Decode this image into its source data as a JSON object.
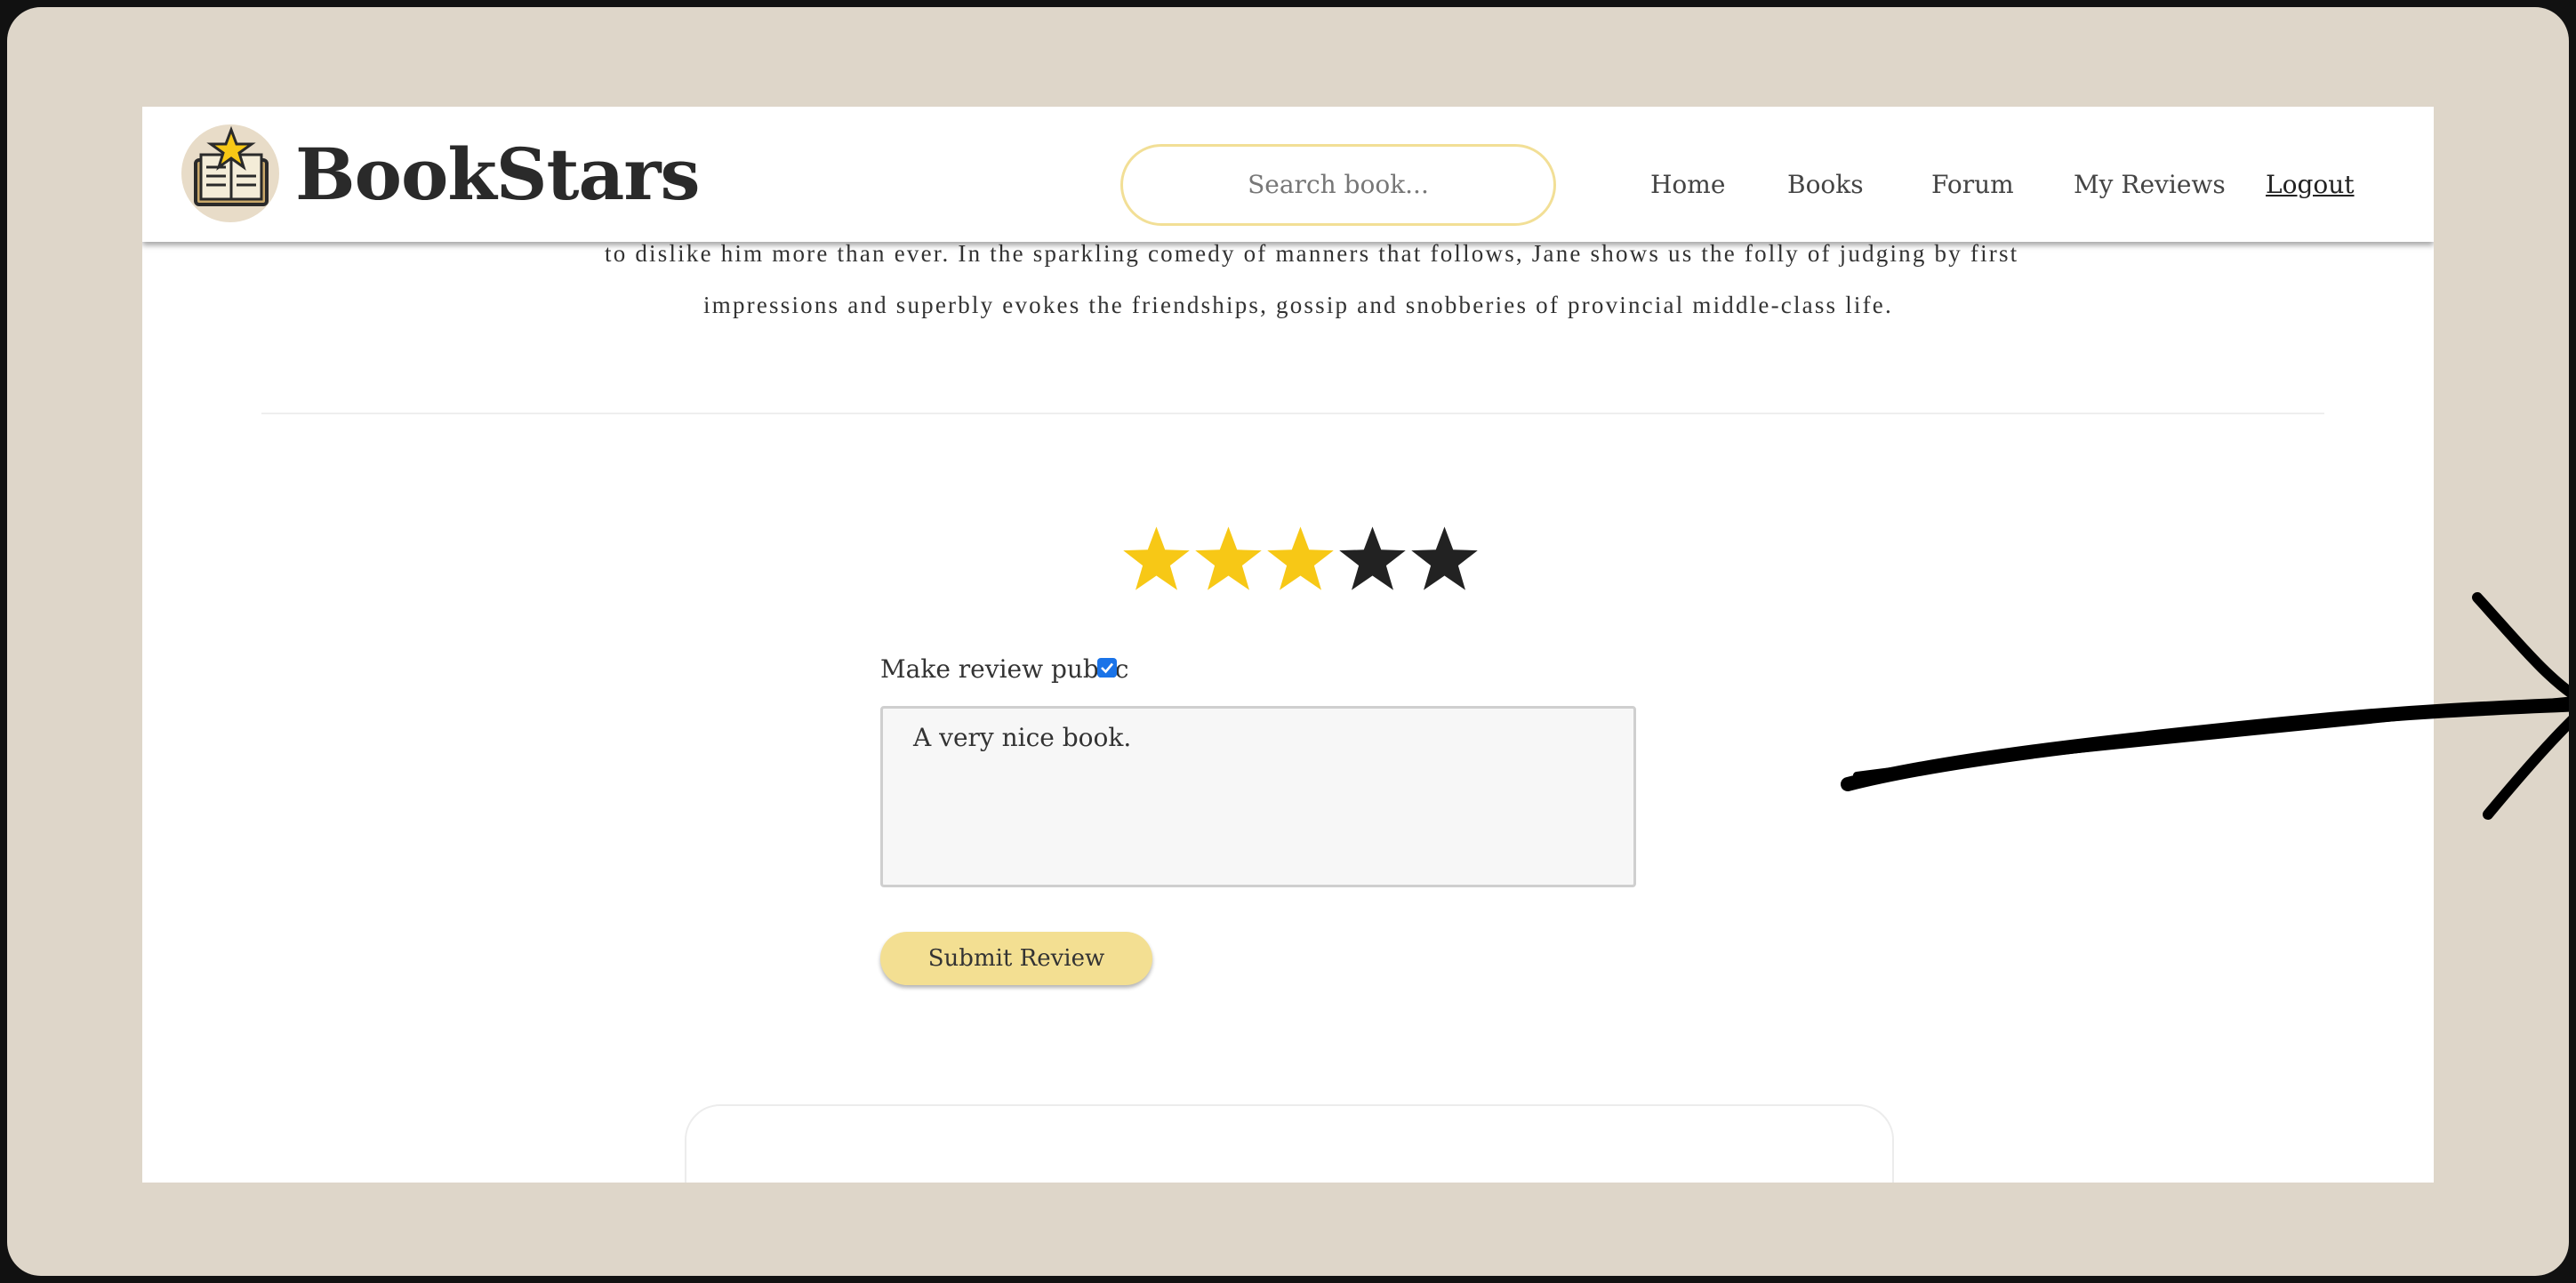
{
  "header": {
    "brand": "BookStars",
    "search_placeholder": "Search book...",
    "nav": {
      "home": "Home",
      "books": "Books",
      "forum": "Forum",
      "my_reviews": "My Reviews",
      "logout": "Logout"
    }
  },
  "book": {
    "description_line_1": "to dislike him more than ever. In the sparkling comedy of manners that follows, Jane shows us the folly of judging by first",
    "description_line_2": "impressions and superbly evokes the friendships, gossip and snobberies of provincial middle-class life."
  },
  "review_form": {
    "rating": 3,
    "max_rating": 5,
    "make_public_label": "Make review public",
    "make_public_checked": true,
    "review_text": "A very nice book.",
    "submit_label": "Submit Review"
  },
  "colors": {
    "star_filled": "#f7c816",
    "star_empty": "#222222",
    "accent": "#f3df92",
    "frame_background": "#ded6c9"
  },
  "icons": {
    "logo": "book-star-logo-icon",
    "annotation": "hand-drawn-arrow-icon"
  }
}
